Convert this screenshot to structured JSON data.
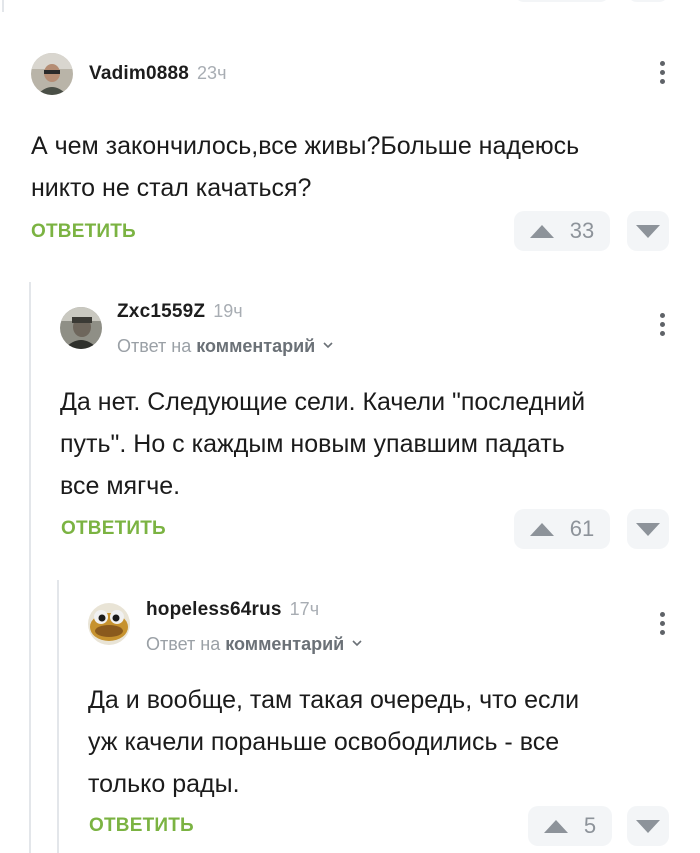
{
  "comments": [
    {
      "author": "Vadim0888",
      "time": "23ч",
      "reply_to": null,
      "lines": [
        "А чем закончилось,все живы?Больше надеюсь",
        "никто не стал качаться?"
      ],
      "reply_label": "ОТВЕТИТЬ",
      "votes": "33"
    },
    {
      "author": "Zxc1559Z",
      "time": "19ч",
      "reply_to": {
        "prefix": "Ответ на",
        "target": "комментарий"
      },
      "lines": [
        "Да нет. Следующие сели. Качели \"последний",
        "путь\". Но с каждым новым упавшим падать",
        "все мягче."
      ],
      "reply_label": "ОТВЕТИТЬ",
      "votes": "61"
    },
    {
      "author": "hopeless64rus",
      "time": "17ч",
      "reply_to": {
        "prefix": "Ответ на",
        "target": "комментарий"
      },
      "lines": [
        "Да и вообще, там такая очередь, что если",
        "уж качели пораньше освободились - все",
        "только рады."
      ],
      "reply_label": "ОТВЕТИТЬ",
      "votes": "5"
    }
  ],
  "icons": {
    "upvote": "upvote-triangle-icon",
    "downvote": "downvote-triangle-icon",
    "more": "more-vertical-icon",
    "chevron": "chevron-down-icon"
  },
  "colors": {
    "reply_green": "#7bb342",
    "vote_bg": "#f3f5f7",
    "vote_icon": "#8d939a",
    "thread_line": "#e3e6ea"
  }
}
